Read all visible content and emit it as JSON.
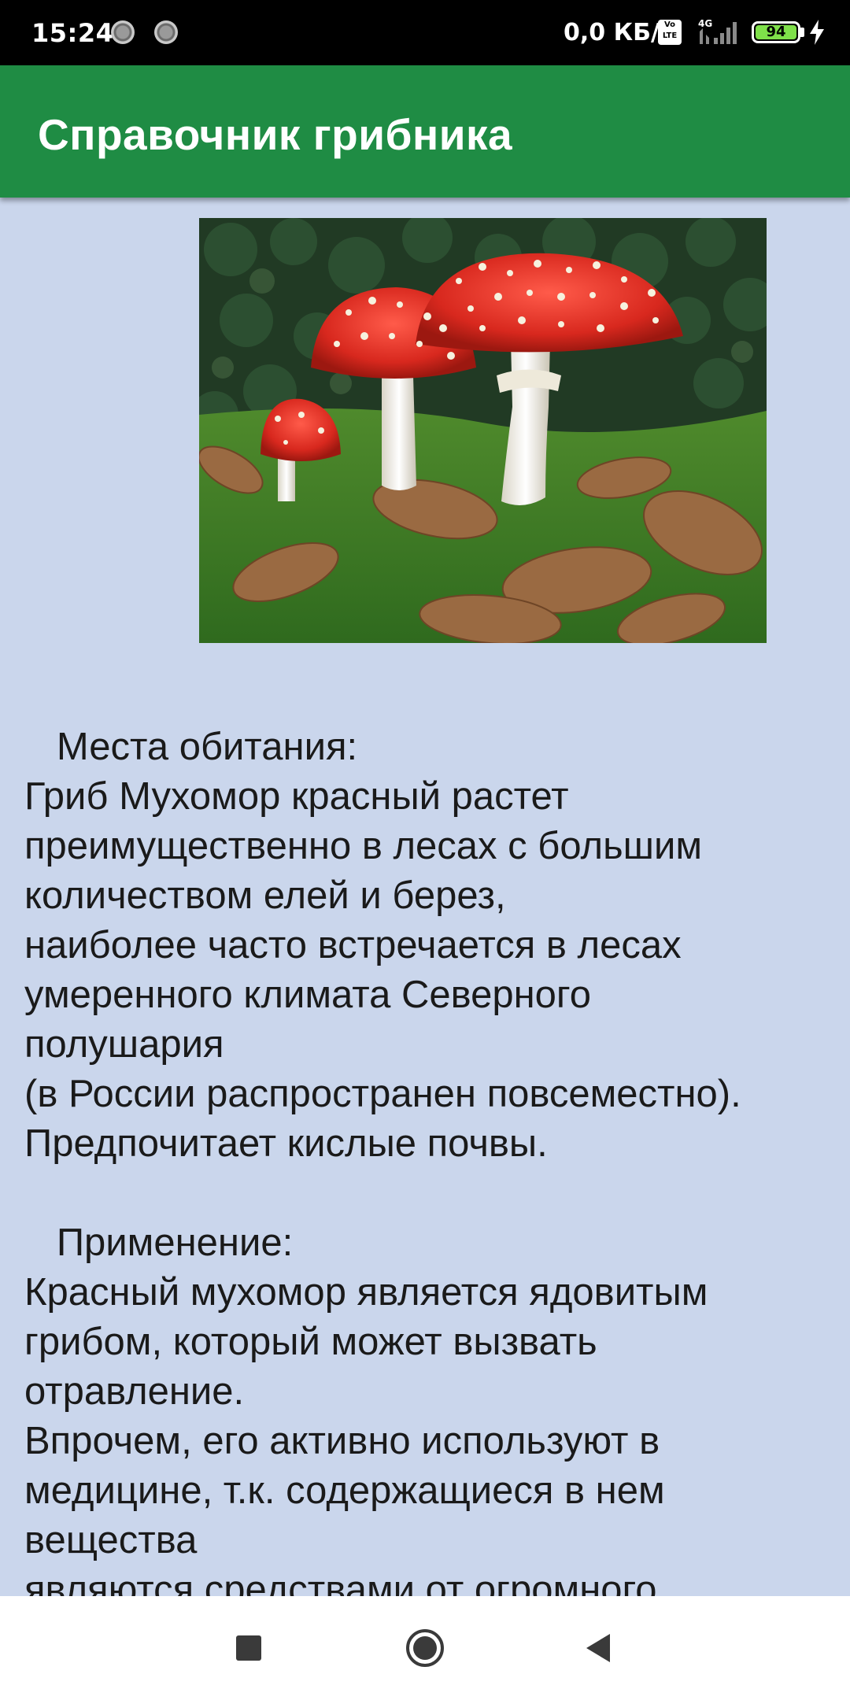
{
  "status_bar": {
    "time": "15:24",
    "network_speed": "0,0 КБ/с",
    "volte_top": "Vo",
    "volte_bottom": "LTE",
    "network_type": "4G",
    "battery_level": "94",
    "icons": [
      "notification-dot-icon",
      "notification-dot-icon",
      "volte-icon",
      "signal-icon",
      "battery-icon",
      "charging-bolt-icon"
    ]
  },
  "app_bar": {
    "title": "Справочник грибника"
  },
  "image": {
    "subject": "fly-agaric-photo"
  },
  "description_lines": [
    "   Места обитания:",
    "Гриб Мухомор красный растет",
    "преимущественно в лесах с большим",
    "количеством елей и берез,",
    "наиболее часто встречается в лесах",
    "умеренного климата Северного",
    "полушария",
    "(в России распространен повсеместно).",
    "Предпочитает кислые почвы.",
    "",
    "   Применение:",
    "Красный мухомор является ядовитым",
    "грибом, который может вызвать",
    "отравление.",
    "Впрочем, его активно используют в",
    "медицине, т.к. содержащиеся в нем",
    "вещества",
    "являются средствами от огромного"
  ],
  "nav_bar": {
    "icons": [
      "recents-square-icon",
      "home-circle-icon",
      "back-triangle-icon"
    ]
  },
  "colors": {
    "status_bar": "#000000",
    "app_bar": "#1f8c44",
    "content_background": "#cad6ec",
    "text": "#1a1a1a",
    "nav_bar": "#ffffff"
  }
}
